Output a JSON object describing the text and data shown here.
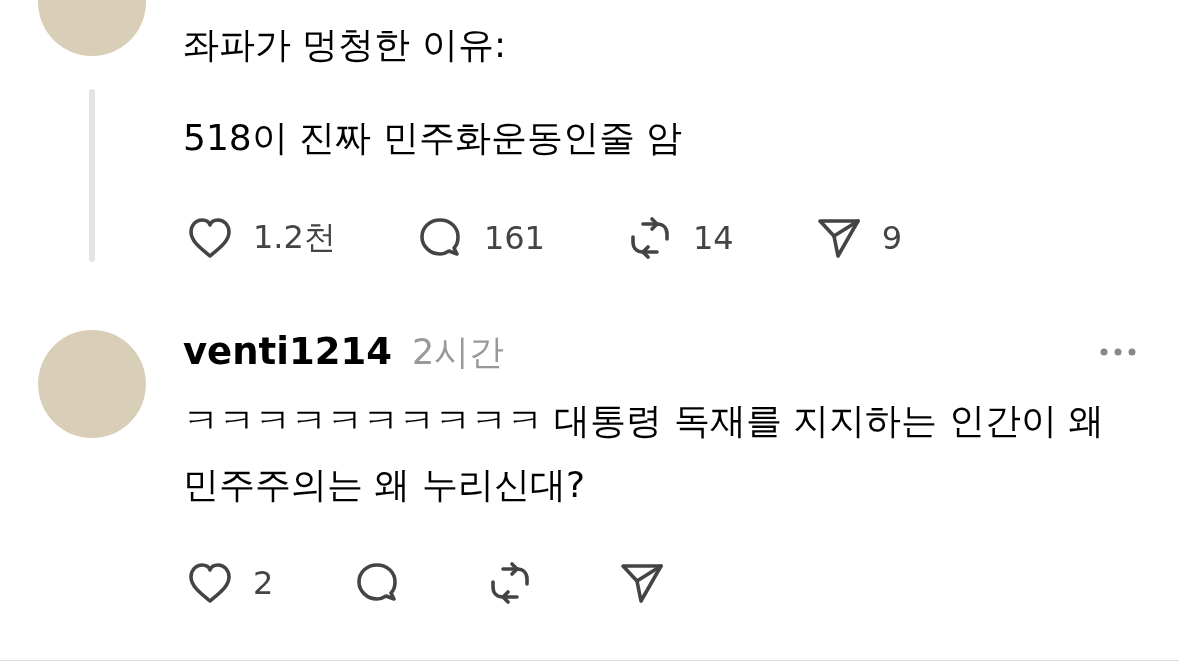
{
  "posts": [
    {
      "kind": "parent",
      "lines": [
        "좌파가 멍청한 이유:",
        "518이 진짜 민주화운동인줄 암"
      ],
      "actions": [
        {
          "kind": "like",
          "count": "1.2천"
        },
        {
          "kind": "reply",
          "count": "161"
        },
        {
          "kind": "repost",
          "count": "14"
        },
        {
          "kind": "share",
          "count": "9"
        }
      ]
    },
    {
      "kind": "reply",
      "username": "venti1214",
      "time": "2시간",
      "text": "ㅋㅋㅋㅋㅋㅋㅋㅋㅋㅋ 대통령 독재를 지지하는 인간이 왜 민주주의는 왜 누리신대?",
      "actions": [
        {
          "kind": "like",
          "count": "2"
        },
        {
          "kind": "reply"
        },
        {
          "kind": "repost"
        },
        {
          "kind": "share"
        }
      ]
    }
  ]
}
